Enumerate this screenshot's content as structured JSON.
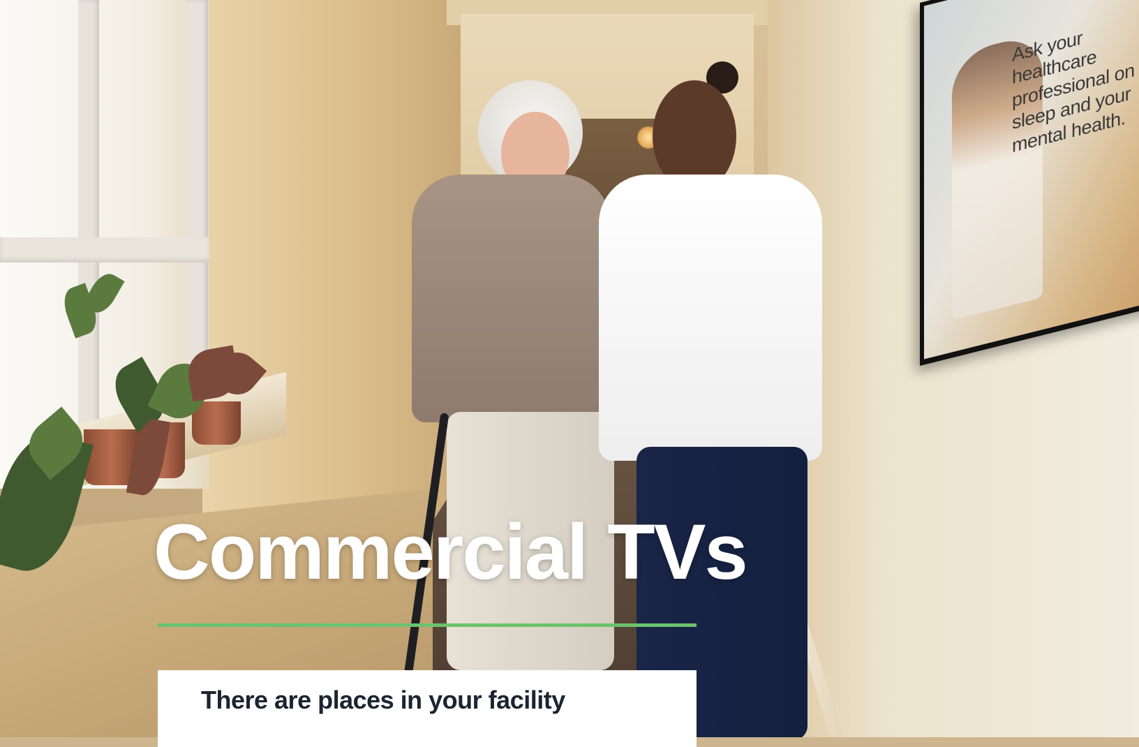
{
  "hero": {
    "headline": "Commercial TVs",
    "accent_color": "#6cc26e"
  },
  "intro_card": {
    "text": "There are places in your facility"
  },
  "wall_screen": {
    "lines": [
      "Ask your healthcare",
      "professional on",
      "sleep and your",
      "mental health."
    ]
  }
}
